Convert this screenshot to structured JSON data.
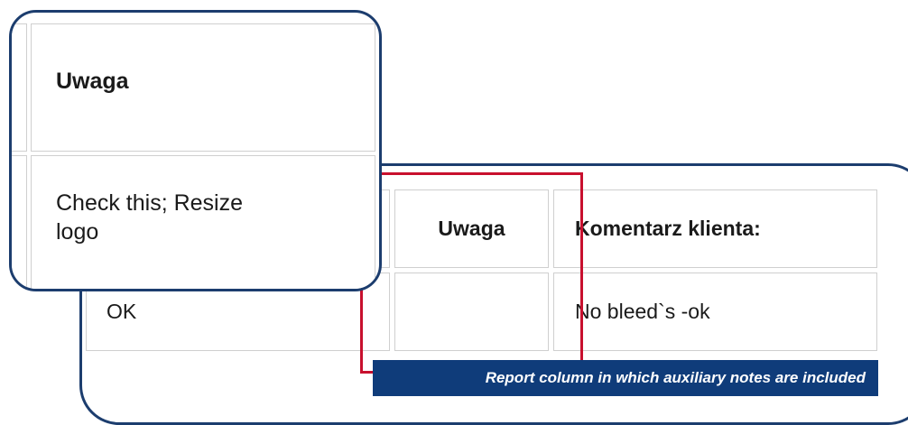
{
  "report_table": {
    "headers": {
      "uwaga": "Uwaga",
      "komentarz": "Komentarz klienta:"
    },
    "row": {
      "status": "OK",
      "uwaga": "",
      "komentarz": "No bleed`s -ok"
    }
  },
  "zoom": {
    "header": "Uwaga",
    "value": "Check this; Resize logo"
  },
  "caption": "Report column in which auxiliary notes are included",
  "colors": {
    "panel_border": "#1c3d6e",
    "highlight": "#c8102e",
    "caption_bg": "#0f3c7a"
  }
}
